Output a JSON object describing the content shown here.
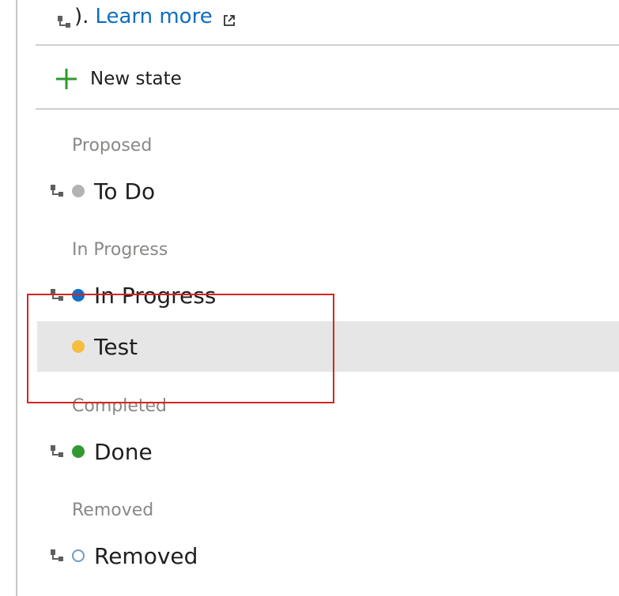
{
  "header": {
    "paren_text": ").",
    "learn_more": "Learn more",
    "inherited_icon": "inherited-icon",
    "external_link_icon": "external-link-icon"
  },
  "toolbar": {
    "new_state_label": "New state",
    "new_state_icon": "plus-icon",
    "new_state_color": "#2c9a2c"
  },
  "groups": [
    {
      "title": "Proposed",
      "states": [
        {
          "label": "To Do",
          "color": "#b3b3b3",
          "inherited": true
        }
      ]
    },
    {
      "title": "In Progress",
      "states": [
        {
          "label": "In Progress",
          "color": "#0f6fc6",
          "inherited": true
        },
        {
          "label": "Test",
          "color": "#f6bd3f",
          "inherited": false,
          "selected": true
        }
      ]
    },
    {
      "title": "Completed",
      "states": [
        {
          "label": "Done",
          "color": "#339933",
          "inherited": true
        }
      ]
    },
    {
      "title": "Removed",
      "states": [
        {
          "label": "Removed",
          "color": "#ffffff",
          "hollow": true,
          "inherited": true
        }
      ]
    }
  ],
  "annotation": {
    "highlight_color": "#d62424"
  }
}
